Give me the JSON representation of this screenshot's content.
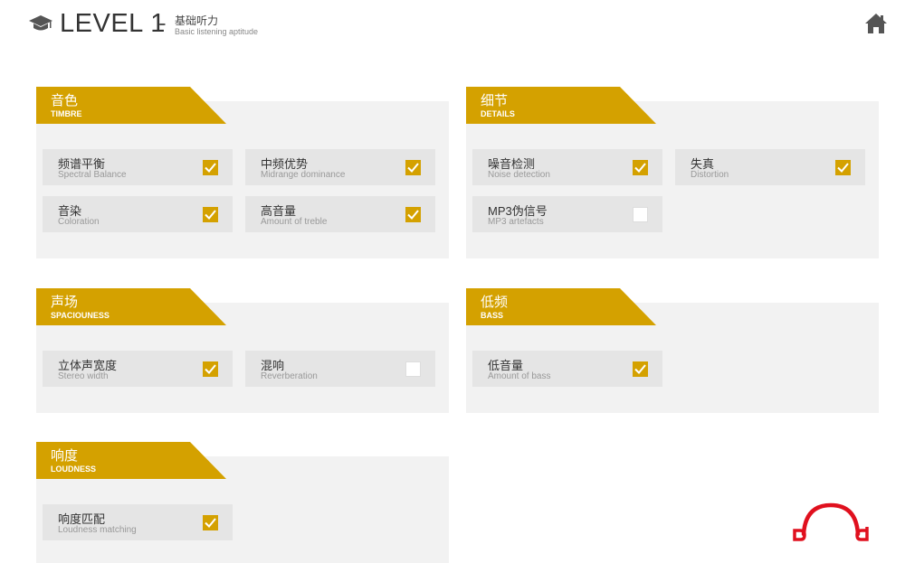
{
  "header": {
    "title": "LEVEL 1",
    "dash": "-",
    "subtitle_zh": "基础听力",
    "subtitle_en": "Basic listening aptitude"
  },
  "icons": {
    "level": "graduation-cap-icon",
    "home": "home-icon",
    "brand": "headphones-logo",
    "check": "check-icon"
  },
  "colors": {
    "accent": "#d4a100",
    "panel_bg": "#f2f2f2",
    "item_bg": "#e5e5e5",
    "logo_red": "#e0101e"
  },
  "sections": {
    "timbre": {
      "title_zh": "音色",
      "title_en": "TIMBRE",
      "items": [
        {
          "zh": "频谱平衡",
          "en": "Spectral Balance",
          "checked": true
        },
        {
          "zh": "中频优势",
          "en": "Midrange dominance",
          "checked": true
        },
        {
          "zh": "音染",
          "en": "Coloration",
          "checked": true
        },
        {
          "zh": "高音量",
          "en": "Amount of treble",
          "checked": true
        }
      ]
    },
    "details": {
      "title_zh": "细节",
      "title_en": "DETAILS",
      "items": [
        {
          "zh": "噪音检测",
          "en": "Noise detection",
          "checked": true
        },
        {
          "zh": "失真",
          "en": "Distortion",
          "checked": true
        },
        {
          "zh": "MP3伪信号",
          "en": "MP3 artefacts",
          "checked": false
        }
      ]
    },
    "spaciousness": {
      "title_zh": "声场",
      "title_en": "SPACIOUNESS",
      "items": [
        {
          "zh": "立体声宽度",
          "en": "Stereo width",
          "checked": true
        },
        {
          "zh": "混响",
          "en": "Reverberation",
          "checked": false
        }
      ]
    },
    "bass": {
      "title_zh": "低频",
      "title_en": "BASS",
      "items": [
        {
          "zh": "低音量",
          "en": "Amount of bass",
          "checked": true
        }
      ]
    },
    "loudness": {
      "title_zh": "响度",
      "title_en": "LOUDNESS",
      "items": [
        {
          "zh": "响度匹配",
          "en": "Loudness matching",
          "checked": true
        }
      ]
    }
  }
}
